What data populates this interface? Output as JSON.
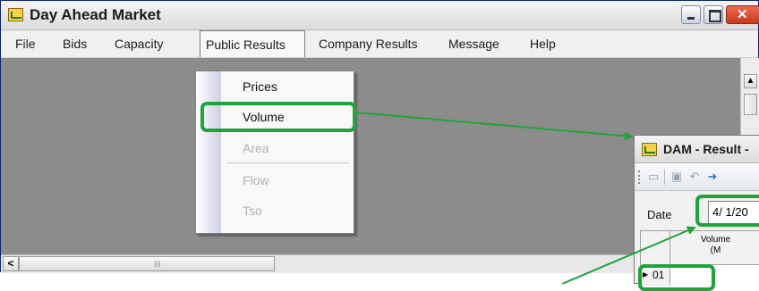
{
  "window": {
    "title": "Day Ahead Market"
  },
  "menu": {
    "file": "File",
    "bids": "Bids",
    "capacity": "Capacity",
    "public_results": "Public Results",
    "company_results": "Company Results",
    "message": "Message",
    "help": "Help"
  },
  "dropdown": {
    "prices": "Prices",
    "volume": "Volume",
    "area": "Area",
    "flow": "Flow",
    "tso": "Tso"
  },
  "scroll": {
    "grip": "III"
  },
  "dam_window": {
    "title": "DAM - Result -",
    "date_label": "Date",
    "date_value": "4/ 1/20",
    "column_header_line1": "Volume",
    "column_header_line2": "(M",
    "row_label": "01"
  },
  "colors": {
    "highlight": "#1fa33a",
    "background": "#8c8c8c"
  }
}
